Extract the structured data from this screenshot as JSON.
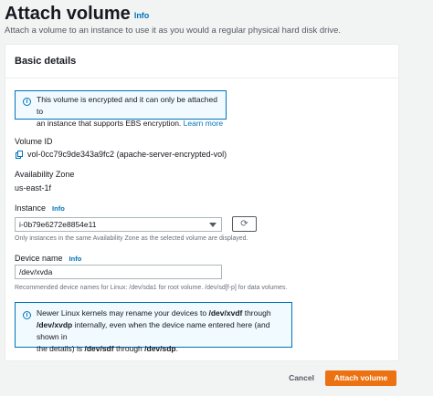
{
  "header": {
    "title": "Attach volume",
    "info": "Info",
    "subtitle": "Attach a volume to an instance to use it as you would a regular physical hard disk drive."
  },
  "card": {
    "title": "Basic details",
    "encryption_alert": {
      "line1": "This volume is encrypted and it can only be attached to",
      "line2_text": "an instance that supports EBS encryption.",
      "learn_more": "Learn more"
    },
    "volume_id": {
      "label": "Volume ID",
      "value": "vol-0cc79c9de343a9fc2 (apache-server-encrypted-vol)"
    },
    "availability_zone": {
      "label": "Availability Zone",
      "value": "us-east-1f"
    },
    "instance": {
      "label": "Instance",
      "info": "Info",
      "selected": "i-0b79e6272e8854e11",
      "hint": "Only instances in the same Availability Zone as the selected volume are displayed."
    },
    "device_name": {
      "label": "Device name",
      "info": "Info",
      "value": "/dev/xvda",
      "hint": "Recommended device names for Linux: /dev/sda1 for root volume. /dev/sd[f-p] for data volumes."
    },
    "kernel_alert": {
      "l1a": "Newer Linux kernels may rename your devices to ",
      "l1b": "/dev/xvdf",
      "l1c": " through",
      "l2a": "/dev/xvdp",
      "l2b": " internally, even when the device name entered here (and shown in",
      "l3a": "the details) is ",
      "l3b": "/dev/sdf",
      "l3c": " through ",
      "l3d": "/dev/sdp",
      "l3e": "."
    }
  },
  "footer": {
    "cancel": "Cancel",
    "attach": "Attach volume"
  }
}
